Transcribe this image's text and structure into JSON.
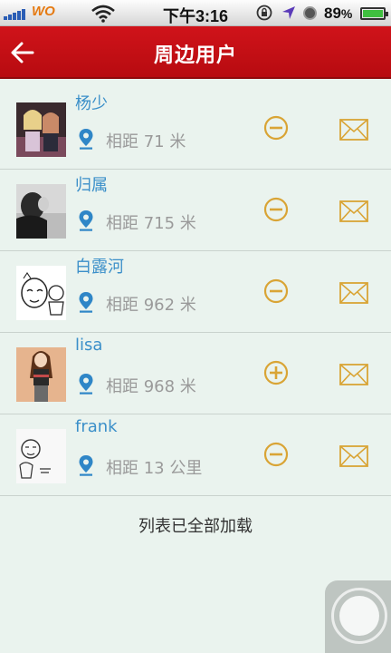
{
  "status_bar": {
    "carrier": "WO",
    "time": "下午3:16",
    "battery_percent": "89",
    "battery_suffix": "%"
  },
  "header": {
    "title": "周边用户",
    "back_icon": "back-arrow-icon"
  },
  "users": [
    {
      "name": "杨少",
      "distance": "相距 71 米",
      "follow_state": "minus"
    },
    {
      "name": "归属",
      "distance": "相距 715 米",
      "follow_state": "minus"
    },
    {
      "name": "白露河",
      "distance": "相距 962 米",
      "follow_state": "minus"
    },
    {
      "name": "lisa",
      "distance": "相距 968 米",
      "follow_state": "plus"
    },
    {
      "name": "frank",
      "distance": "相距 13 公里",
      "follow_state": "minus"
    }
  ],
  "footer": {
    "end_text": "列表已全部加载"
  },
  "colors": {
    "header_red": "#c40f14",
    "name_blue": "#3b8fc9",
    "icon_gold": "#d9a435",
    "pin_blue": "#2f86c7",
    "background": "#eaf3ee"
  }
}
